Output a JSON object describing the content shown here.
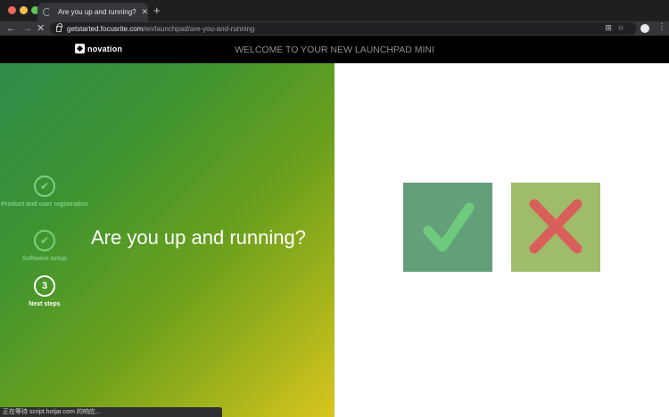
{
  "browser": {
    "tab_title": "Are you up and running? | Get",
    "tab_close": "✕",
    "new_tab": "+",
    "url_host": "getstarted.focusrite.com",
    "url_path": "/en/launchpad/are-you-and-running",
    "omni_icons": "⊞☆",
    "menu": "⋮",
    "back": "←",
    "forward": "→",
    "stop": "✕",
    "status_text": "正在等待 script.hotjar.com 的响应..."
  },
  "header": {
    "logo_text": "novation",
    "title": "WELCOME TO YOUR NEW LAUNCHPAD MINI"
  },
  "steps": [
    {
      "symbol": "✔",
      "label": "Product and user registration",
      "state": "done"
    },
    {
      "symbol": "✔",
      "label": "Software setup",
      "state": "done"
    },
    {
      "symbol": "3",
      "label": "Next steps",
      "state": "current"
    }
  ],
  "main": {
    "headline": "Are you up and running?"
  },
  "answers": {
    "yes_icon": "checkmark-icon",
    "no_icon": "cross-icon"
  },
  "colors": {
    "yes_tile": "#63a07a",
    "yes_mark": "#6fca7d",
    "no_tile": "#9fbc6b",
    "no_mark": "#d9605a",
    "step_done": "#7fcf86"
  }
}
